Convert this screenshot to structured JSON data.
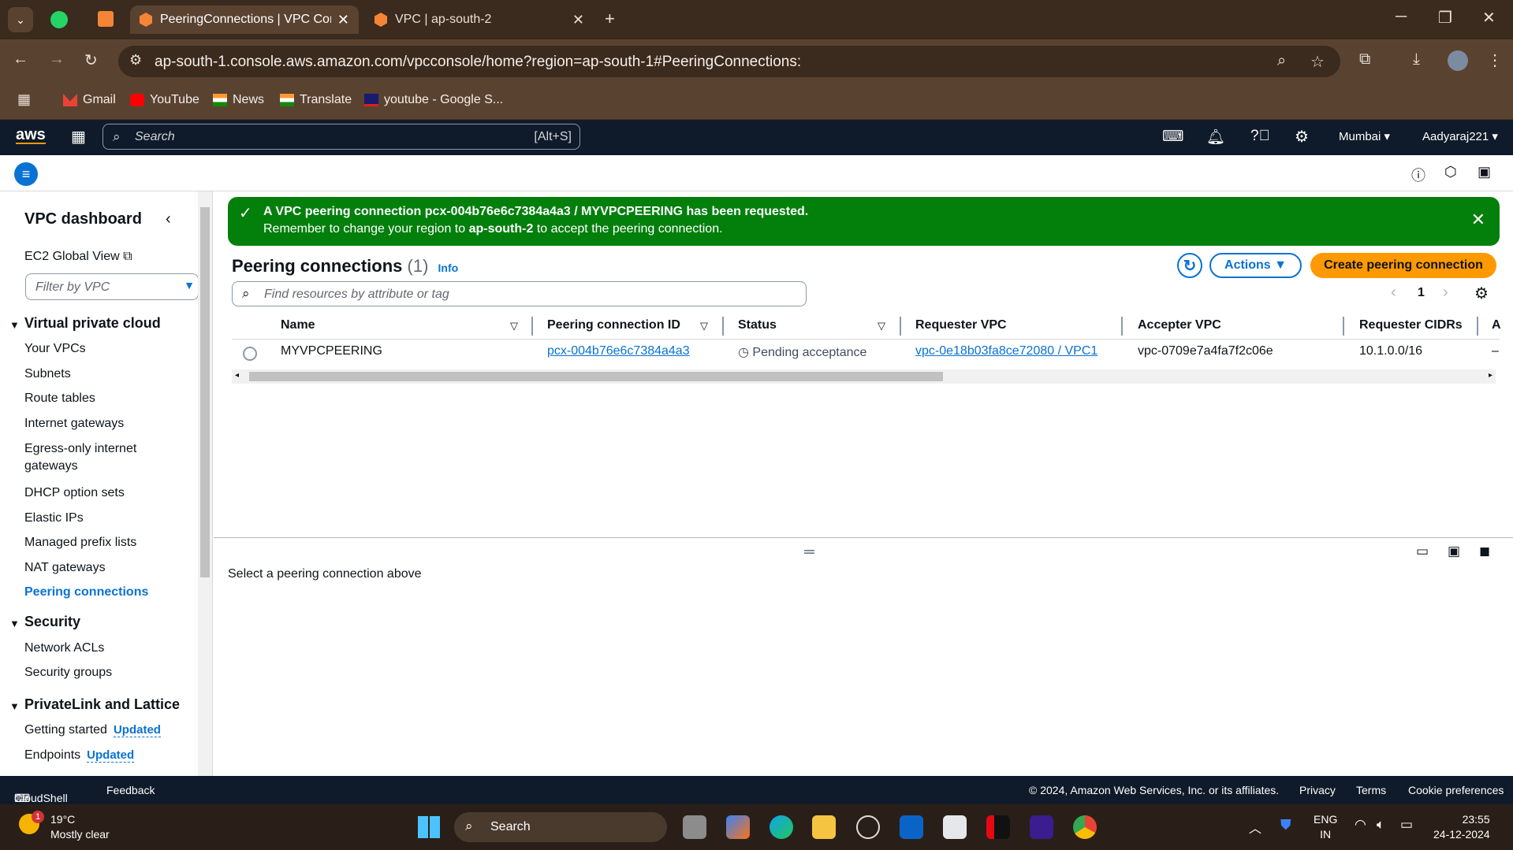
{
  "browser": {
    "tabs": [
      {
        "title": "PeeringConnections | VPC Console"
      },
      {
        "title": "VPC | ap-south-2"
      }
    ],
    "url": "ap-south-1.console.aws.amazon.com/vpcconsole/home?region=ap-south-1#PeeringConnections:",
    "bookmarks": [
      "Gmail",
      "YouTube",
      "News",
      "Translate",
      "youtube - Google S..."
    ]
  },
  "awsnav": {
    "logo": "aws",
    "search_placeholder": "Search",
    "search_shortcut": "[Alt+S]",
    "region": "Mumbai",
    "account": "Aadyaraj221"
  },
  "sidebar": {
    "title": "VPC dashboard",
    "global_view": "EC2 Global View",
    "filter_placeholder": "Filter by VPC",
    "section_vpc": "Virtual private cloud",
    "vpc_items": [
      "Your VPCs",
      "Subnets",
      "Route tables",
      "Internet gateways",
      "Egress-only internet",
      "gateways",
      "DHCP option sets",
      "Elastic IPs",
      "Managed prefix lists",
      "NAT gateways",
      "Peering connections"
    ],
    "section_security": "Security",
    "security_items": [
      "Network ACLs",
      "Security groups"
    ],
    "section_privatelink": "PrivateLink and Lattice",
    "privatelink_items": [
      "Getting started",
      "Endpoints"
    ],
    "updated_badge": "Updated"
  },
  "flash": {
    "line1_pre": "A VPC peering connection ",
    "line1_id": "pcx-004b76e6c7384a4a3 / MYVPCPEERING",
    "line1_post": " has been requested.",
    "line2_pre": "Remember to change your region to ",
    "line2_region": "ap-south-2",
    "line2_post": " to accept the peering connection."
  },
  "main": {
    "title": "Peering connections",
    "count": "(1)",
    "info": "Info",
    "actions": "Actions",
    "create": "Create peering connection",
    "search_placeholder": "Find resources by attribute or tag",
    "page": "1",
    "columns": [
      "Name",
      "Peering connection ID",
      "Status",
      "Requester VPC",
      "Accepter VPC",
      "Requester CIDRs",
      "A"
    ],
    "row": {
      "name": "MYVPCPEERING",
      "id": "pcx-004b76e6c7384a4a3",
      "status": "Pending acceptance",
      "requester": "vpc-0e18b03fa8ce72080 / VPC1",
      "accepter": "vpc-0709e7a4fa7f2c06e",
      "cidrs": "10.1.0.0/16",
      "extra": "–"
    },
    "detail_empty": "Select a peering connection above"
  },
  "footer": {
    "cloudshell": "CloudShell",
    "feedback": "Feedback",
    "copyright": "© 2024, Amazon Web Services, Inc. or its affiliates.",
    "privacy": "Privacy",
    "terms": "Terms",
    "cookies": "Cookie preferences"
  },
  "taskbar": {
    "weather_temp": "19°C",
    "weather_desc": "Mostly clear",
    "weather_badge": "1",
    "search": "Search",
    "lang1": "ENG",
    "lang2": "IN",
    "time": "23:55",
    "date": "24-12-2024"
  },
  "colors": {
    "flash_green": "#037f0c",
    "link_blue": "#0972d3",
    "create_orange": "#ff9900",
    "aws_nav": "#0f1b2a"
  }
}
